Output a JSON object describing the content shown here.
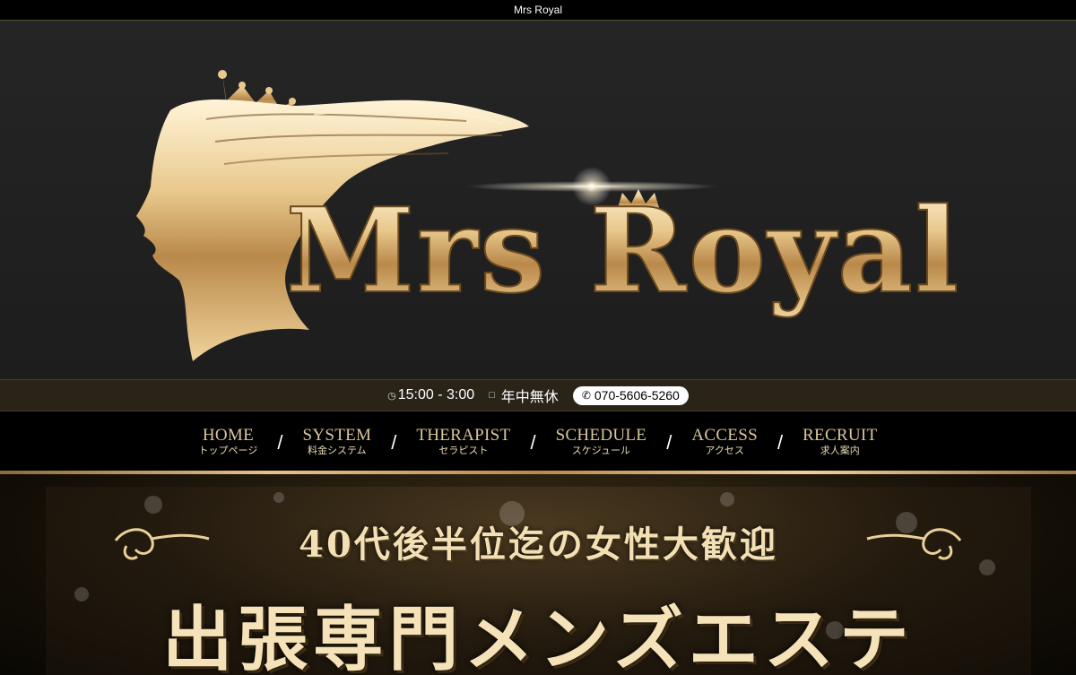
{
  "site": {
    "title": "Mrs Royal"
  },
  "logo": {
    "text": "Mrs Royal"
  },
  "info": {
    "hours": "15:00 - 3:00",
    "holiday": "年中無休",
    "phone": "070-5606-5260",
    "icons": {
      "hours": "clock-icon",
      "holiday": "calendar-icon",
      "phone": "phone-icon"
    }
  },
  "nav": {
    "items": [
      {
        "en": "HOME",
        "ja": "トップページ"
      },
      {
        "en": "SYSTEM",
        "ja": "料金システム"
      },
      {
        "en": "THERAPIST",
        "ja": "セラピスト"
      },
      {
        "en": "SCHEDULE",
        "ja": "スケジュール"
      },
      {
        "en": "ACCESS",
        "ja": "アクセス"
      },
      {
        "en": "RECRUIT",
        "ja": "求人案内"
      }
    ],
    "separator": "/"
  },
  "banner": {
    "line1": "40代後半位迄の女性大歓迎",
    "line2": "出張専門メンズエステ"
  },
  "colors": {
    "gold": "#d9c69a",
    "goldBright": "#f0cf9a",
    "background": "#000000",
    "heroBackground": "#222222"
  }
}
